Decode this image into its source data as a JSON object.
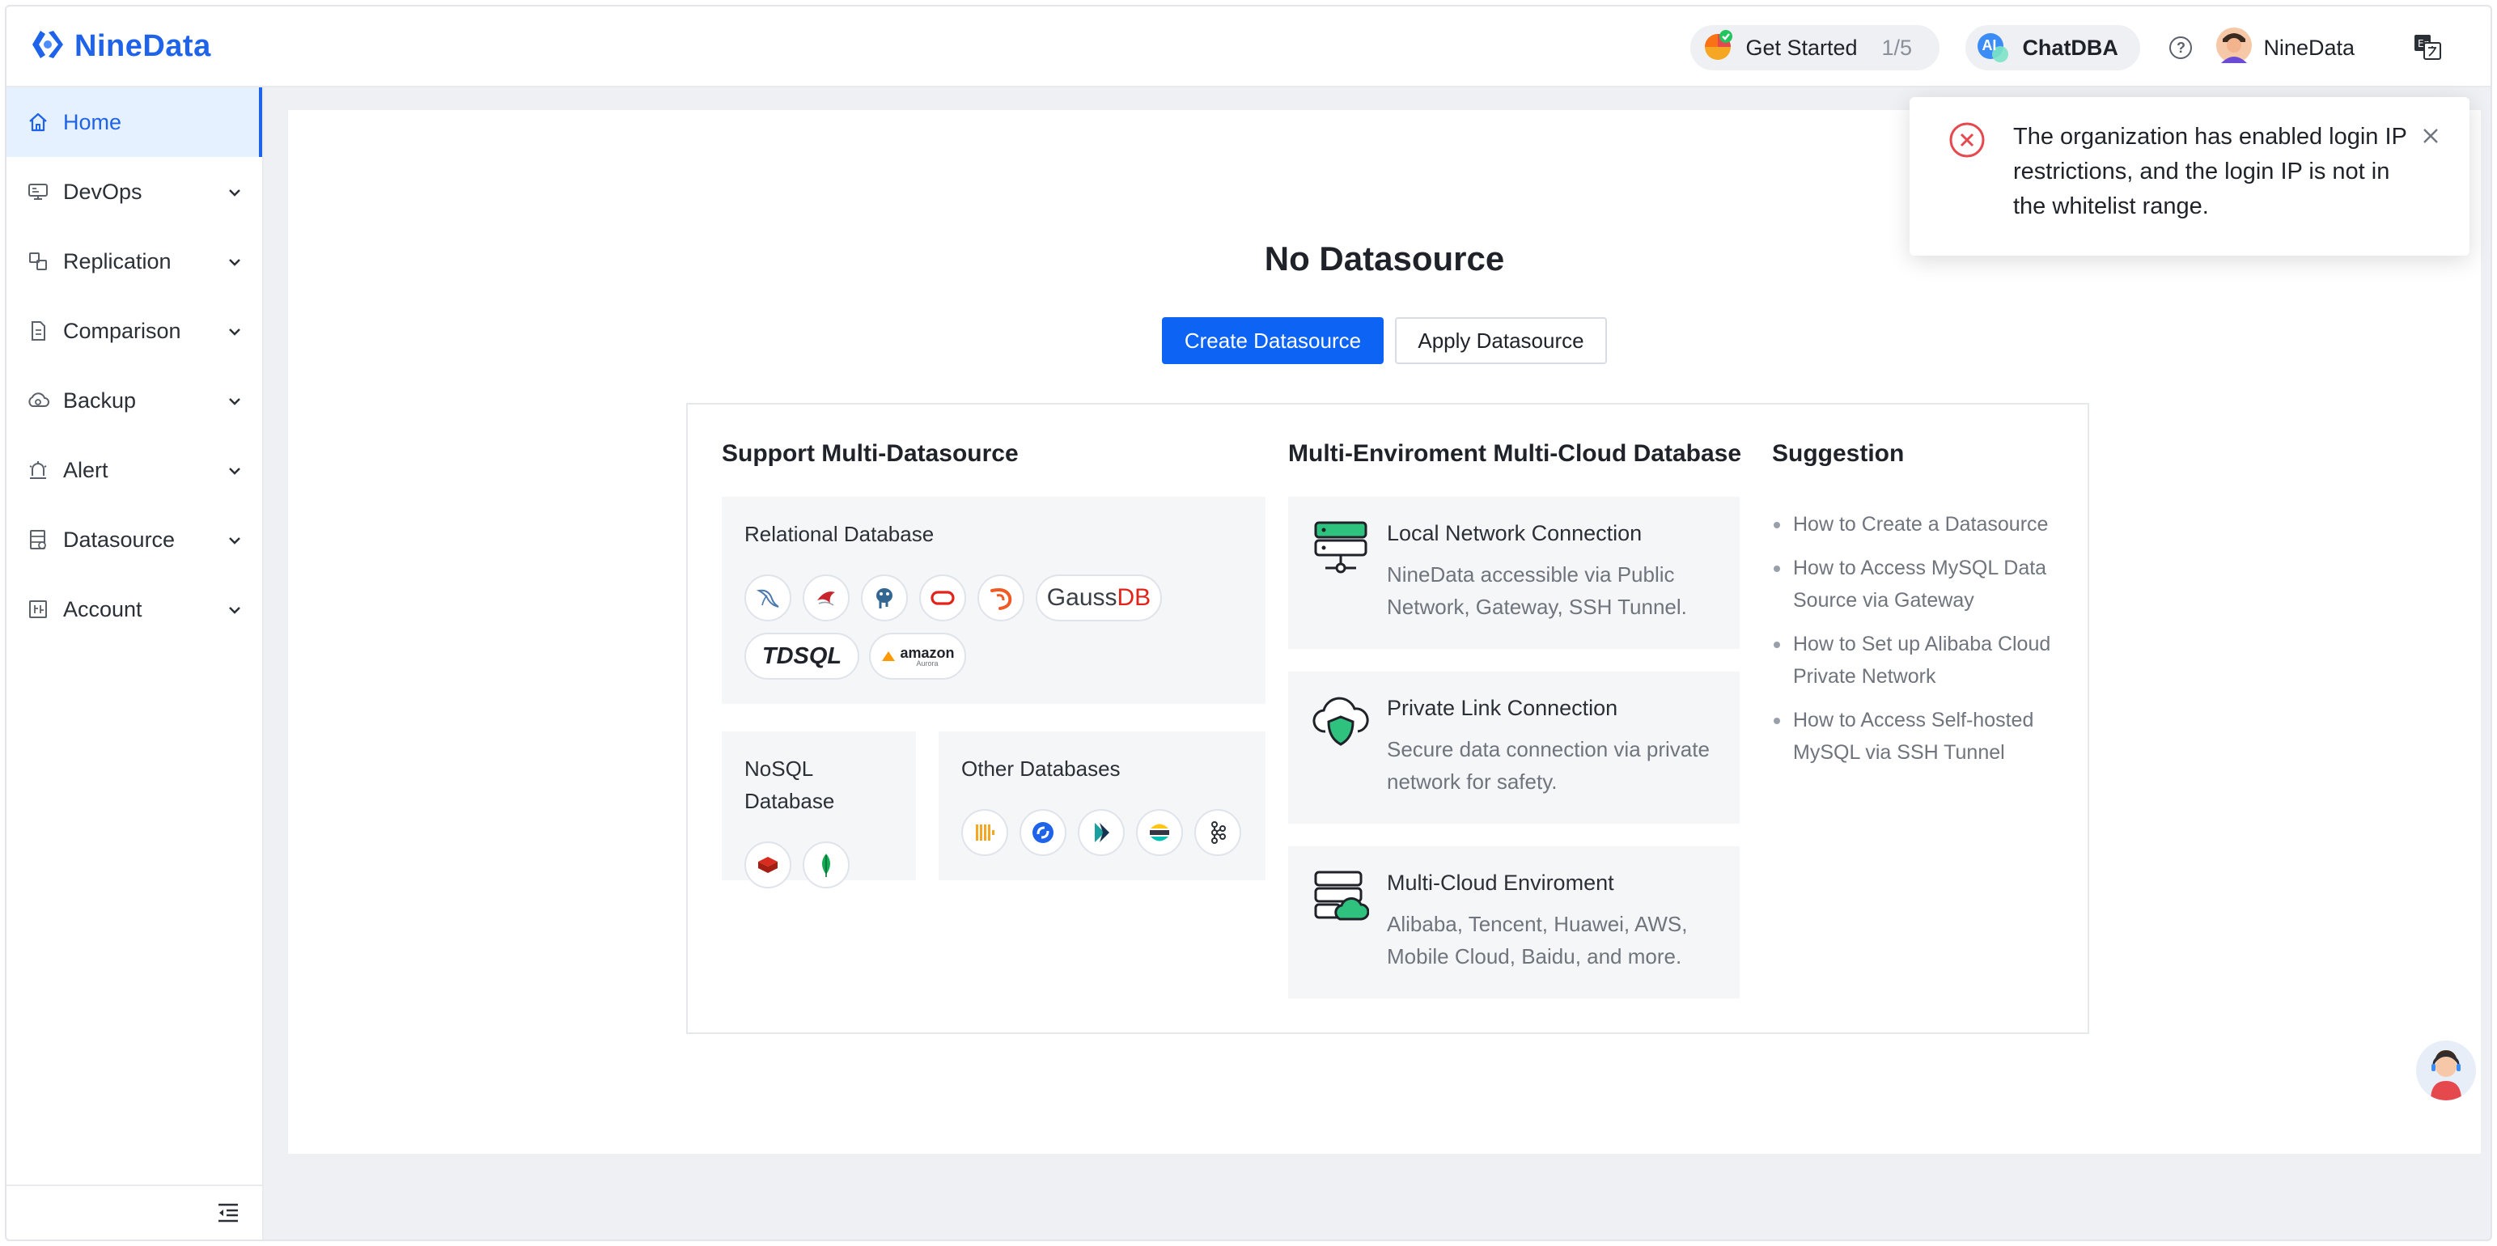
{
  "header": {
    "brand": "NineData",
    "get_started": {
      "label": "Get Started",
      "progress": "1/5"
    },
    "chatdba": {
      "badge": "AI",
      "label": "ChatDBA"
    },
    "help_icon": "question-circle-icon",
    "user_name": "NineData",
    "language_icon": "translate-icon"
  },
  "sidebar": {
    "items": [
      {
        "label": "Home",
        "icon": "home-icon",
        "active": true
      },
      {
        "label": "DevOps",
        "icon": "devops-icon"
      },
      {
        "label": "Replication",
        "icon": "replication-icon"
      },
      {
        "label": "Comparison",
        "icon": "comparison-icon"
      },
      {
        "label": "Backup",
        "icon": "backup-icon"
      },
      {
        "label": "Alert",
        "icon": "alert-icon"
      },
      {
        "label": "Datasource",
        "icon": "datasource-icon"
      },
      {
        "label": "Account",
        "icon": "account-icon"
      }
    ],
    "collapse_icon": "menu-fold-icon"
  },
  "main": {
    "title": "No Datasource",
    "create_button": "Create Datasource",
    "apply_button": "Apply Datasource",
    "support": {
      "title": "Support Multi-Datasource",
      "relational": {
        "title": "Relational Database",
        "icons": [
          "mysql-icon",
          "sqlserver-icon",
          "postgresql-icon",
          "oracle-icon",
          "mariadb-icon"
        ],
        "gaussdb_a": "Gauss",
        "gaussdb_b": "DB",
        "tdsql": "TDSQL",
        "amazon": "amazon",
        "amazon_sub": "Aurora"
      },
      "nosql": {
        "title_line1": "NoSQL",
        "title_line2": "Database",
        "icons": [
          "redis-icon",
          "mongodb-icon"
        ]
      },
      "other": {
        "title": "Other Databases",
        "icons": [
          "clickhouse-icon",
          "selectdb-icon",
          "kingbase-icon",
          "elasticsearch-icon",
          "kafka-icon"
        ]
      }
    },
    "environment": {
      "title": "Multi-Enviroment Multi-Cloud Database",
      "items": [
        {
          "name": "Local Network Connection",
          "desc": "NineData accessible via Public Network, Gateway, SSH Tunnel.",
          "icon": "server-network-icon"
        },
        {
          "name": "Private Link Connection",
          "desc": "Secure data connection via private network for safety.",
          "icon": "cloud-shield-icon"
        },
        {
          "name": "Multi-Cloud Enviroment",
          "desc": "Alibaba, Tencent, Huawei, AWS, Mobile Cloud, Baidu, and more.",
          "icon": "server-cloud-icon"
        }
      ]
    },
    "suggestion": {
      "title": "Suggestion",
      "links": [
        "How to Create a Datasource",
        "How to Access MySQL Data Source via Gateway",
        "How to Set up Alibaba Cloud Private Network",
        "How to Access Self-hosted MySQL via SSH Tunnel"
      ]
    }
  },
  "toast": {
    "message": "The organization has enabled login IP restrictions, and the login IP is not in the whitelist range.",
    "icon": "error-circle-icon",
    "close_icon": "close-icon"
  },
  "support_avatar_icon": "customer-service-icon",
  "colors": {
    "brand": "#1e63e9",
    "primary_button": "#0d63f3",
    "error": "#e5484d",
    "active_bg": "#e6f1ff"
  }
}
